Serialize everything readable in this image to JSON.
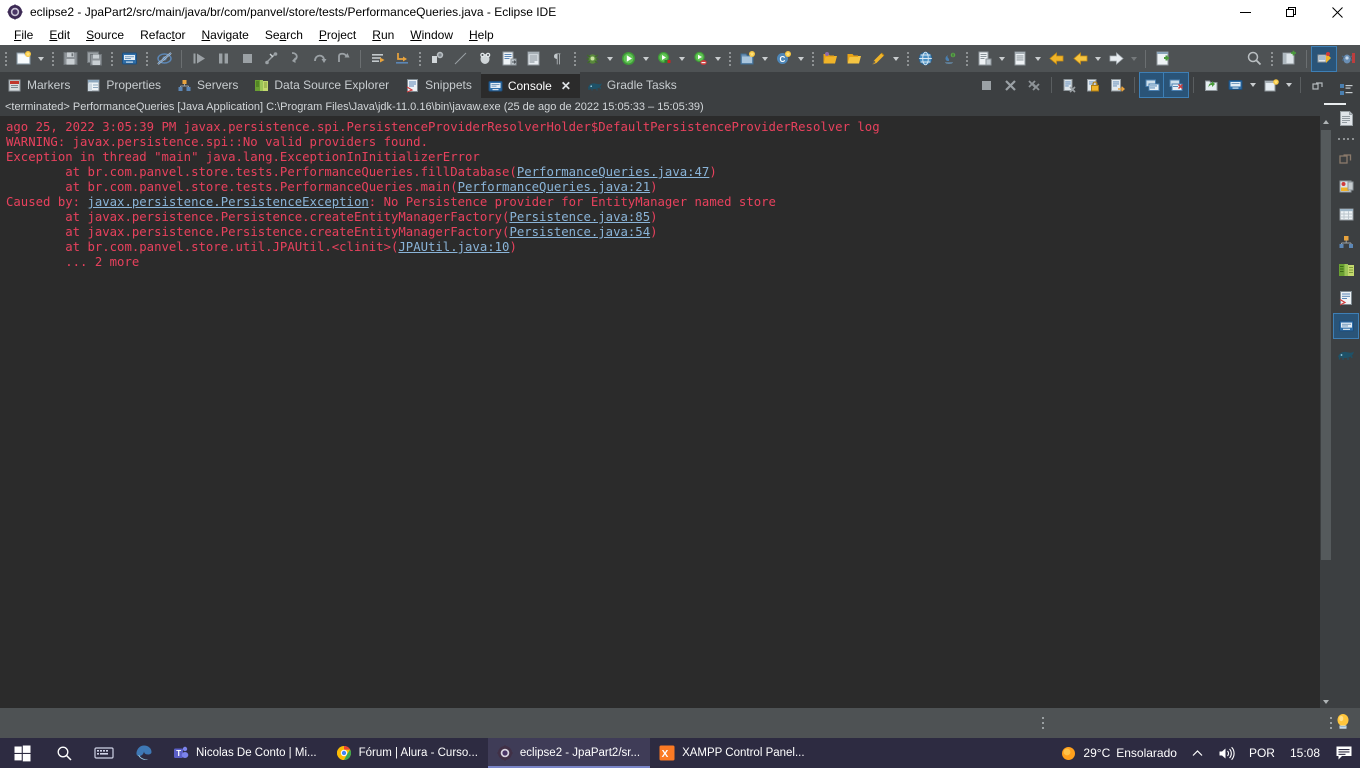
{
  "window": {
    "title": "eclipse2 - JpaPart2/src/main/java/br/com/panvel/store/tests/PerformanceQueries.java - Eclipse IDE",
    "minimize_label": "—",
    "maximize_label": "❐",
    "close_label": "✕"
  },
  "menu": {
    "items": [
      {
        "label": "File",
        "mnemonic": "F"
      },
      {
        "label": "Edit",
        "mnemonic": "E"
      },
      {
        "label": "Source",
        "mnemonic": "S"
      },
      {
        "label": "Refactor",
        "mnemonic": "t"
      },
      {
        "label": "Navigate",
        "mnemonic": "N"
      },
      {
        "label": "Search",
        "mnemonic": "a"
      },
      {
        "label": "Project",
        "mnemonic": "P"
      },
      {
        "label": "Run",
        "mnemonic": "R"
      },
      {
        "label": "Window",
        "mnemonic": "W"
      },
      {
        "label": "Help",
        "mnemonic": "H"
      }
    ]
  },
  "toolbar": {
    "buttons": [
      "new-wizard-icon",
      "save-icon",
      "save-all-icon",
      "print-console-icon",
      "toggle-mark-occurrences-icon",
      "skip-breakpoints-icon",
      "pause-icon",
      "terminate-icon",
      "disconnect-icon",
      "step-into-icon",
      "step-over-icon",
      "step-return-icon",
      "next-annotation-icon",
      "previous-annotation-icon",
      "toggle-breakpoint-icon",
      "last-edit-location-icon",
      "debug-as-icon",
      "open-type-icon",
      "open-task-icon",
      "pilcrow-icon",
      "debug-icon",
      "run-icon",
      "run-coverage-icon",
      "profile-icon",
      "new-java-project-icon",
      "new-java-class-icon",
      "open-package-icon",
      "open-resource-icon",
      "annotate-icon",
      "web-browser-icon",
      "java-perspective-icon",
      "new-report-icon",
      "generate-icon",
      "back-icon",
      "forward-nav-icon",
      "forward-icon",
      "new-window-icon",
      "search-icon",
      "new-perspective-icon",
      "java-ee-perspective-icon",
      "debug-perspective-icon"
    ]
  },
  "view_tabs": {
    "items": [
      {
        "label": "Markers",
        "icon": "markers-icon",
        "active": false
      },
      {
        "label": "Properties",
        "icon": "properties-icon",
        "active": false
      },
      {
        "label": "Servers",
        "icon": "servers-icon",
        "active": false
      },
      {
        "label": "Data Source Explorer",
        "icon": "data-source-explorer-icon",
        "active": false
      },
      {
        "label": "Snippets",
        "icon": "snippets-icon",
        "active": false
      },
      {
        "label": "Console",
        "icon": "console-icon",
        "active": true,
        "close": "✕"
      },
      {
        "label": "Gradle Tasks",
        "icon": "gradle-tasks-icon",
        "active": false
      }
    ],
    "right_actions": [
      "terminate-icon",
      "remove-launch-icon",
      "remove-all-launches-icon",
      "clear-console-icon",
      "scroll-lock-icon",
      "show-console-on-output-icon",
      "pin-console-icon",
      "display-selected-console-icon",
      "open-console-icon",
      "open-console-dropdown-icon",
      "new-console-view-icon",
      "new-console-dropdown-icon",
      "minimize-maximize-icon"
    ]
  },
  "fast_view_bar": {
    "items": [
      "outline-icon",
      "task-list-icon",
      "restore-icon",
      "project-explorer-icon",
      "data-source-icon",
      "servers-icon",
      "data-source-explorer-icon",
      "snippets-icon",
      "console-icon",
      "gradle-tasks-icon"
    ],
    "selected": "console-icon"
  },
  "console": {
    "status_line": "<terminated> PerformanceQueries [Java Application] C:\\Program Files\\Java\\jdk-11.0.16\\bin\\javaw.exe  (25 de ago de 2022 15:05:33 – 15:05:39)",
    "lines": [
      {
        "segments": [
          {
            "t": "ago 25, 2022 3:05:39 PM javax.persistence.spi.PersistenceProviderResolverHolder$DefaultPersistenceProviderResolver log",
            "k": "err"
          }
        ]
      },
      {
        "segments": [
          {
            "t": "WARNING: javax.persistence.spi::No valid providers found.",
            "k": "err"
          }
        ]
      },
      {
        "segments": [
          {
            "t": "Exception in thread \"main\" java.lang.ExceptionInInitializerError",
            "k": "err"
          }
        ]
      },
      {
        "segments": [
          {
            "t": "\tat br.com.panvel.store.tests.PerformanceQueries.fillDatabase(",
            "k": "err"
          },
          {
            "t": "PerformanceQueries.java:47",
            "k": "link"
          },
          {
            "t": ")",
            "k": "err"
          }
        ]
      },
      {
        "segments": [
          {
            "t": "\tat br.com.panvel.store.tests.PerformanceQueries.main(",
            "k": "err"
          },
          {
            "t": "PerformanceQueries.java:21",
            "k": "link"
          },
          {
            "t": ")",
            "k": "err"
          }
        ]
      },
      {
        "segments": [
          {
            "t": "Caused by: ",
            "k": "err"
          },
          {
            "t": "javax.persistence.PersistenceException",
            "k": "link"
          },
          {
            "t": ": No Persistence provider for EntityManager named store",
            "k": "err"
          }
        ]
      },
      {
        "segments": [
          {
            "t": "\tat javax.persistence.Persistence.createEntityManagerFactory(",
            "k": "err"
          },
          {
            "t": "Persistence.java:85",
            "k": "link"
          },
          {
            "t": ")",
            "k": "err"
          }
        ]
      },
      {
        "segments": [
          {
            "t": "\tat javax.persistence.Persistence.createEntityManagerFactory(",
            "k": "err"
          },
          {
            "t": "Persistence.java:54",
            "k": "link"
          },
          {
            "t": ")",
            "k": "err"
          }
        ]
      },
      {
        "segments": [
          {
            "t": "\tat br.com.panvel.store.util.JPAUtil.<clinit>(",
            "k": "err"
          },
          {
            "t": "JPAUtil.java:10",
            "k": "link"
          },
          {
            "t": ")",
            "k": "err"
          }
        ]
      },
      {
        "segments": [
          {
            "t": "\t... 2 more",
            "k": "err"
          }
        ]
      }
    ]
  },
  "taskbar": {
    "start_icon": "windows-start-icon",
    "search_icon": "search-icon",
    "taskview_icon": "task-view-icon",
    "edge_icon": "edge-icon",
    "items": [
      {
        "label": "Nicolas De Conto | Mi...",
        "icon": "microsoft-teams-icon",
        "active": false
      },
      {
        "label": "Fórum | Alura - Curso...",
        "icon": "chrome-icon",
        "active": false
      },
      {
        "label": "eclipse2 - JpaPart2/sr...",
        "icon": "eclipse-icon",
        "active": true
      },
      {
        "label": "XAMPP Control Panel...",
        "icon": "xampp-icon",
        "active": false
      }
    ],
    "tray": {
      "weather_temp": "29°C",
      "weather_text": "Ensolarado",
      "weather_icon": "sun-icon",
      "chevron_icon": "chevron-up-icon",
      "volume_icon": "volume-icon",
      "language": "POR",
      "clock": "15:08",
      "notifications_icon": "notifications-icon"
    }
  },
  "colors": {
    "toolbar_bg": "#4e5254",
    "tab_bg": "#3c3f41",
    "console_bg": "#2b2b2b",
    "error_text": "#e8415d",
    "link_text": "#8ab4d8",
    "taskbar_bg": "#2d2b41",
    "selection": "#2a5478"
  }
}
